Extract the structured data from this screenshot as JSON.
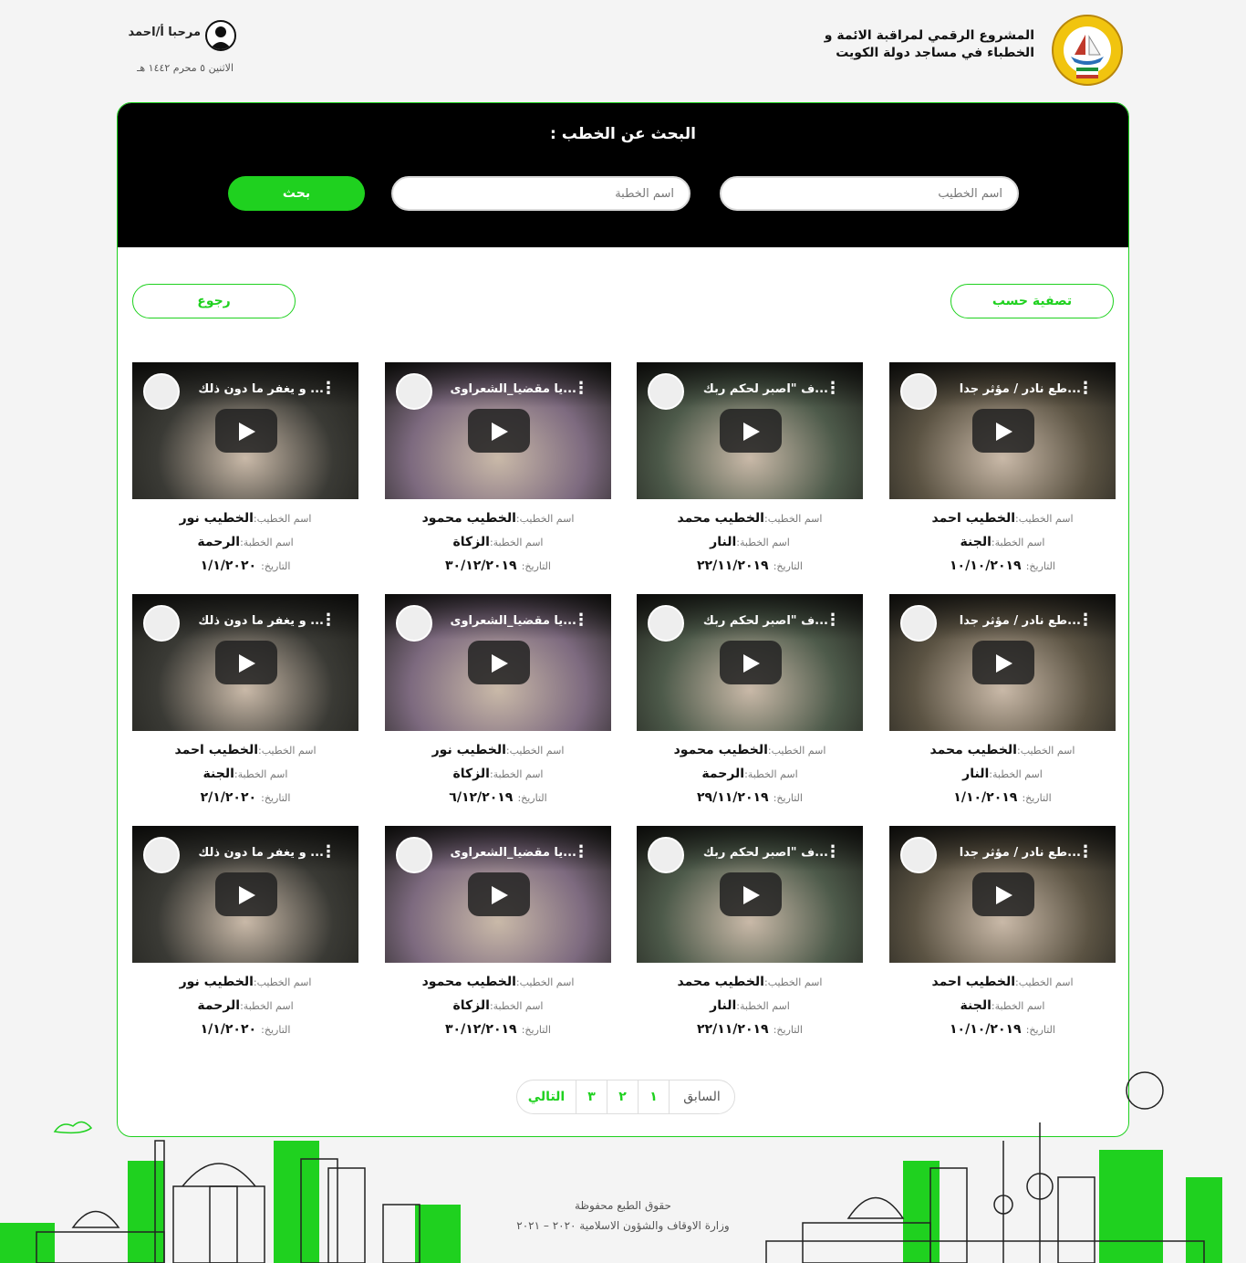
{
  "header": {
    "site_title_line1": "المشروع الرقمي لمراقبة الائمة و",
    "site_title_line2": "الخطباء في مساجد دولة الكويت",
    "welcome": "مرحبا أ/احمد",
    "hijri_date": "الاثنين ٥ محرم ١٤٤٢ هـ"
  },
  "search": {
    "title": "البحث عن الخطب :",
    "speaker_placeholder": "اسم الخطيب",
    "sermon_placeholder": "اسم الخطبة",
    "button": "بحث"
  },
  "actions": {
    "filter": "تصفية حسب",
    "back": "رجوع"
  },
  "labels": {
    "speaker": "اسم الخطيب:",
    "sermon": "اسم الخطبة:",
    "date": "التاريخ:"
  },
  "videos": [
    {
      "title": "...طع نادر / مؤثر جدا",
      "speaker": "الخطيب احمد",
      "sermon": "الجنة",
      "date": "١٠/١٠/٢٠١٩",
      "thumb_color": "#5b5343"
    },
    {
      "title": "...ف \"اصبر لحكم ربك",
      "speaker": "الخطيب محمد",
      "sermon": "النار",
      "date": "٢٢/١١/٢٠١٩",
      "thumb_color": "#4d5a4a"
    },
    {
      "title": "...يا مقضيا_الشعراوى",
      "speaker": "الخطيب محمود",
      "sermon": "الزكاة",
      "date": "٣٠/١٢/٢٠١٩",
      "thumb_color": "#7d6a7f"
    },
    {
      "title": "... و يغفر ما دون ذلك",
      "speaker": "الخطيب نور",
      "sermon": "الرحمة",
      "date": "١/١/٢٠٢٠",
      "thumb_color": "#3a3a35"
    },
    {
      "title": "...طع نادر / مؤثر جدا",
      "speaker": "الخطيب محمد",
      "sermon": "النار",
      "date": "١/١٠/٢٠١٩",
      "thumb_color": "#5b5343"
    },
    {
      "title": "...ف \"اصبر لحكم ربك",
      "speaker": "الخطيب محمود",
      "sermon": "الرحمة",
      "date": "٢٩/١١/٢٠١٩",
      "thumb_color": "#4d5a4a"
    },
    {
      "title": "...يا مقضيا_الشعراوى",
      "speaker": "الخطيب نور",
      "sermon": "الزكاة",
      "date": "٦/١٢/٢٠١٩",
      "thumb_color": "#7d6a7f"
    },
    {
      "title": "... و يغفر ما دون ذلك",
      "speaker": "الخطيب احمد",
      "sermon": "الجنة",
      "date": "٢/١/٢٠٢٠",
      "thumb_color": "#3a3a35"
    },
    {
      "title": "...طع نادر / مؤثر جدا",
      "speaker": "الخطيب احمد",
      "sermon": "الجنة",
      "date": "١٠/١٠/٢٠١٩",
      "thumb_color": "#5b5343"
    },
    {
      "title": "...ف \"اصبر لحكم ربك",
      "speaker": "الخطيب محمد",
      "sermon": "النار",
      "date": "٢٢/١١/٢٠١٩",
      "thumb_color": "#4d5a4a"
    },
    {
      "title": "...يا مقضيا_الشعراوى",
      "speaker": "الخطيب محمود",
      "sermon": "الزكاة",
      "date": "٣٠/١٢/٢٠١٩",
      "thumb_color": "#7d6a7f"
    },
    {
      "title": "... و يغفر ما دون ذلك",
      "speaker": "الخطيب نور",
      "sermon": "الرحمة",
      "date": "١/١/٢٠٢٠",
      "thumb_color": "#3a3a35"
    }
  ],
  "pagination": {
    "prev": "السابق",
    "pages": [
      "١",
      "٢",
      "٣"
    ],
    "next": "التالي"
  },
  "footer": {
    "line1": "حقوق الطبع محفوظة",
    "line2": "وزارة الاوقاف والشؤون الاسلامية ٢٠٢٠ – ٢٠٢١"
  },
  "colors": {
    "accent": "#1fd11f",
    "search_bg": "#000000",
    "page_bg": "#f4f4f4"
  },
  "icons": [
    "kuwait-emblem-logo",
    "user-avatar-icon",
    "youtube-play-icon",
    "more-vert-icon"
  ]
}
